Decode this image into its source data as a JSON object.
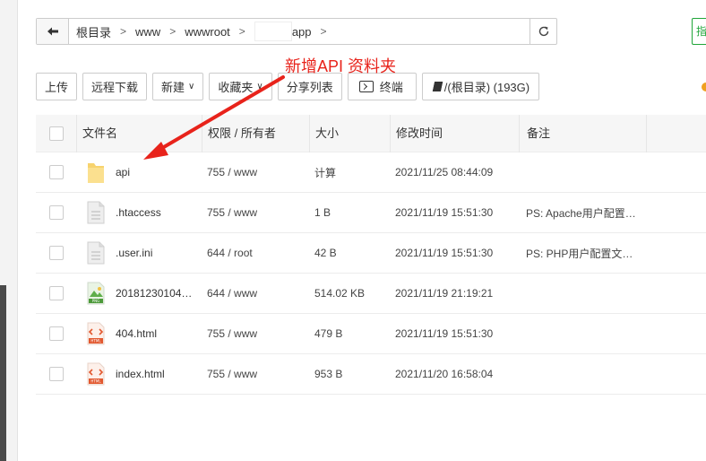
{
  "breadcrumb": {
    "items": [
      "根目录",
      "www",
      "wwwroot",
      "app"
    ]
  },
  "right_edge_button": {
    "label": "指"
  },
  "toolbar": {
    "upload": "上传",
    "remote_download": "远程下载",
    "new": "新建",
    "favorites": "收藏夹",
    "share_list": "分享列表",
    "terminal": "终端",
    "disk": "/(根目录) (193G)"
  },
  "annotation": {
    "text": "新增API 资料夹",
    "color": "#e8231b"
  },
  "table": {
    "headers": {
      "name": "文件名",
      "perm": "权限 / 所有者",
      "size": "大小",
      "time": "修改时间",
      "note": "备注"
    },
    "rows": [
      {
        "icon": "folder-icon",
        "name": "api",
        "perm": "755 / www",
        "size": "计算",
        "time": "2021/11/25 08:44:09",
        "note": ""
      },
      {
        "icon": "file-icon",
        "name": ".htaccess",
        "perm": "755 / www",
        "size": "1 B",
        "time": "2021/11/19 15:51:30",
        "note": "PS: Apache用户配置…"
      },
      {
        "icon": "file-icon",
        "name": ".user.ini",
        "perm": "644 / root",
        "size": "42 B",
        "time": "2021/11/19 15:51:30",
        "note": "PS: PHP用户配置文…"
      },
      {
        "icon": "png-icon",
        "name": "20181230104…",
        "perm": "644 / www",
        "size": "514.02 KB",
        "time": "2021/11/19 21:19:21",
        "note": ""
      },
      {
        "icon": "html-icon",
        "name": "404.html",
        "perm": "755 / www",
        "size": "479 B",
        "time": "2021/11/19 15:51:30",
        "note": ""
      },
      {
        "icon": "html-icon",
        "name": "index.html",
        "perm": "755 / www",
        "size": "953 B",
        "time": "2021/11/20 16:58:04",
        "note": ""
      }
    ]
  },
  "colors": {
    "accent_green": "#20a53a",
    "annotation_red": "#e8231b",
    "folder": "#f7d36e"
  }
}
